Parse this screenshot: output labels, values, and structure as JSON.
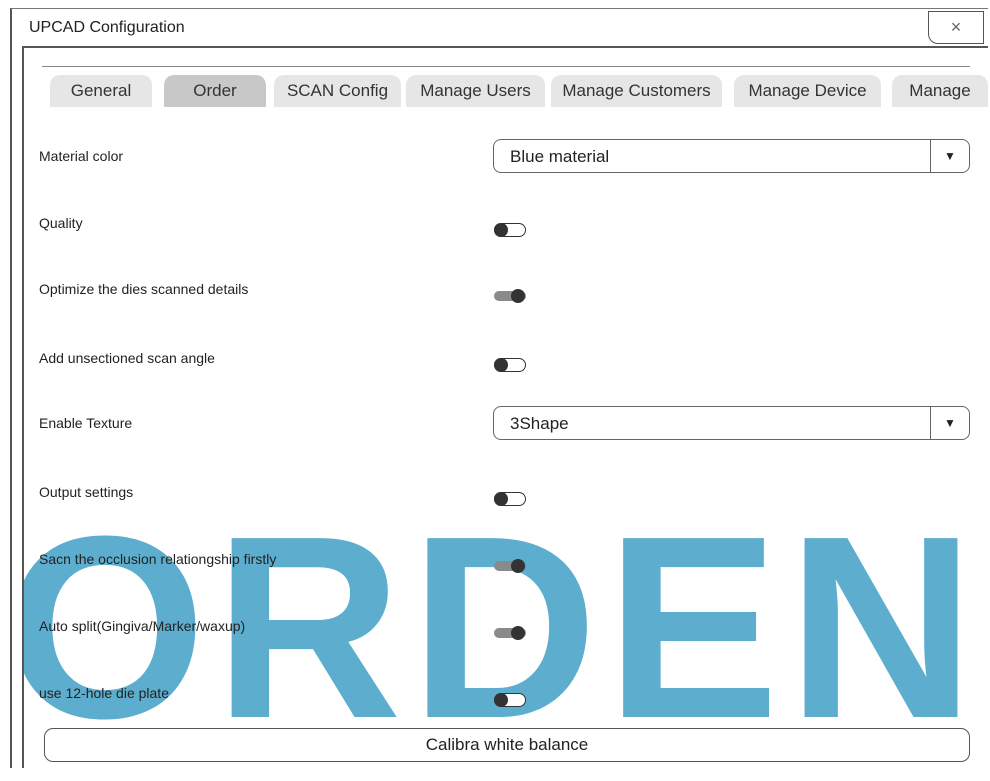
{
  "window": {
    "title": "UPCAD Configuration",
    "close_glyph": "×"
  },
  "tabs": [
    {
      "label": "General",
      "active": false
    },
    {
      "label": "Order",
      "active": true
    },
    {
      "label": "SCAN Config",
      "active": false
    },
    {
      "label": "Manage Users",
      "active": false
    },
    {
      "label": "Manage Customers",
      "active": false
    },
    {
      "label": "Manage Device",
      "active": false
    },
    {
      "label": "Manage",
      "active": false
    }
  ],
  "settings": [
    {
      "label": "Material color",
      "control": "select",
      "value": "Blue material"
    },
    {
      "label": "Quality",
      "control": "toggle",
      "on": false
    },
    {
      "label": "Optimize the dies scanned details",
      "control": "toggle",
      "on": true
    },
    {
      "label": "Add unsectioned scan angle",
      "control": "toggle",
      "on": false
    },
    {
      "label": "Enable Texture",
      "control": "select",
      "value": "3Shape"
    },
    {
      "label": "Output settings",
      "control": "toggle",
      "on": false
    },
    {
      "label": "Sacn the occlusion relationgship firstly",
      "control": "toggle",
      "on": true
    },
    {
      "label": "Auto split(Gingiva/Marker/waxup)",
      "control": "toggle",
      "on": true
    },
    {
      "label": "use 12-hole  die plate",
      "control": "toggle",
      "on": false
    }
  ],
  "select_arrow": "▼",
  "calibrate_button": "Calibra white balance",
  "watermark": "ORDEN",
  "colors": {
    "watermark": "#3a9cc4",
    "toggle_on": "#8a8a8a",
    "active_tab": "#c8c8c8"
  }
}
